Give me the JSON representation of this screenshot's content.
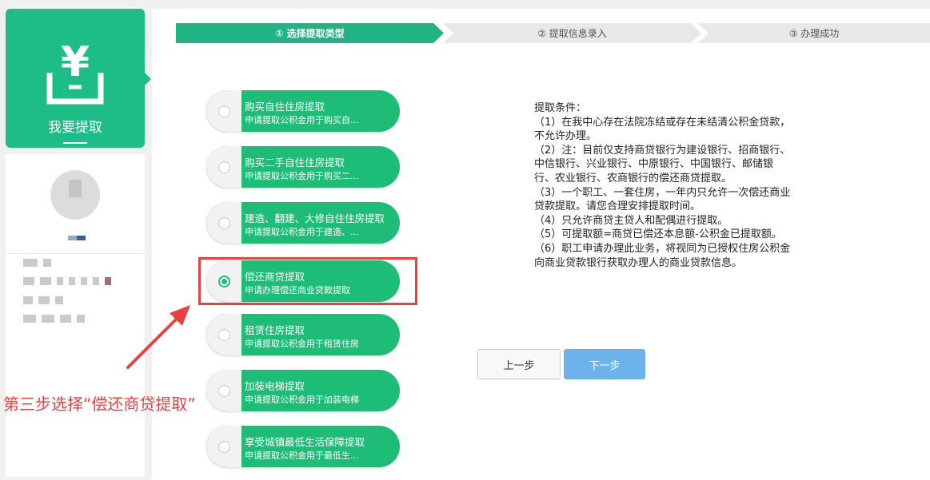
{
  "sidebar": {
    "title": "我要提取",
    "icon": "yuan-withdraw-icon"
  },
  "steps": [
    {
      "label": "① 选择提取类型",
      "active": true
    },
    {
      "label": "② 提取信息录入",
      "active": false
    },
    {
      "label": "③ 办理成功",
      "active": false
    }
  ],
  "options": [
    {
      "title": "购买自住住房提取",
      "subtitle": "申请提取公积金用于购买自...",
      "checked": false
    },
    {
      "title": "购买二手自住住房提取",
      "subtitle": "申请提取公积金用于购买二...",
      "checked": false
    },
    {
      "title": "建造、翻建、大修自住住房提取",
      "subtitle": "申请提取公积金用于建造、...",
      "checked": false
    },
    {
      "title": "偿还商贷提取",
      "subtitle": "申请办理偿还商业贷款提取",
      "checked": true
    },
    {
      "title": "租赁住房提取",
      "subtitle": "申请提取公积金用于租赁住房",
      "checked": false
    },
    {
      "title": "加装电梯提取",
      "subtitle": "申请提取公积金用于加装电梯",
      "checked": false
    },
    {
      "title": "享受城镇最低生活保障提取",
      "subtitle": "申请提取公积金用于最低生...",
      "checked": false
    }
  ],
  "conditions": {
    "heading": "提取条件：",
    "lines": [
      "（1）在我中心存在法院冻结或存在未结清公积金贷款，",
      "不允许办理。",
      "（2）注：目前仅支持商贷银行为建设银行、招商银行、",
      "中信银行、兴业银行、中原银行、中国银行、邮储银",
      "行、农业银行、农商银行的偿还商贷提取。",
      "（3）一个职工、一套住房，一年内只允许一次偿还商业",
      "贷款提取。请您合理安排提取时间。",
      "（4）只允许商贷主贷人和配偶进行提取。",
      "（5）可提取额=商贷已偿还本息额-公积金已提取额。",
      "（6）职工申请办理此业务，将视同为已授权住房公积金",
      "向商业贷款银行获取办理人的商业贷款信息。"
    ]
  },
  "buttons": {
    "prev": "上一步",
    "next": "下一步"
  },
  "annotation": {
    "text": "第三步选择“偿还商贷提取”"
  },
  "colors": {
    "brand_green": "#1ebd88",
    "option_green": "#1ebd77",
    "highlight_red": "#e8413f",
    "next_blue": "#6cb3ec"
  }
}
